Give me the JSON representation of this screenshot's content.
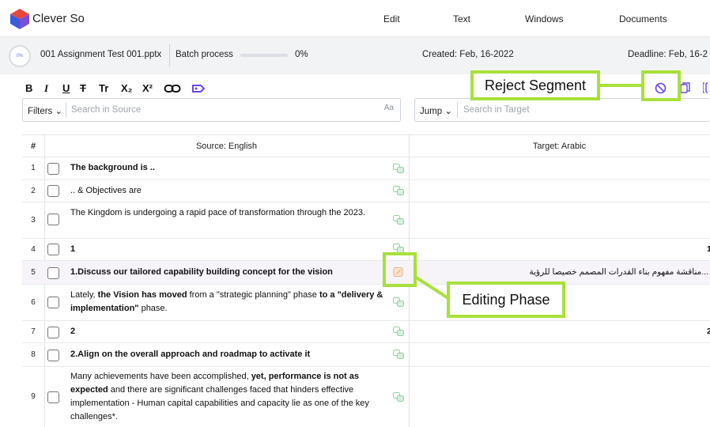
{
  "app": {
    "brand": "Clever So"
  },
  "nav": {
    "edit": "Edit",
    "text": "Text",
    "windows": "Windows",
    "documents": "Documents"
  },
  "filebar": {
    "progress": "0%",
    "filename": "001 Assignment Test 001.pptx",
    "batch_label": "Batch process",
    "batch_progress": 0,
    "batch_pct": "0%",
    "created": "Created: Feb, 16-2022",
    "deadline": "Deadline: Feb, 16-2"
  },
  "toolbar": {
    "bold": "B",
    "italic": "I",
    "underline": "U",
    "strike": "T",
    "font_size": "Tr",
    "subscript": "X₂",
    "superscript": "X²"
  },
  "filters": {
    "label": "Filters",
    "placeholder": "Search in Source",
    "case": "Aa"
  },
  "jump": {
    "label": "Jump",
    "placeholder": "Search in Target"
  },
  "table": {
    "col_num": "#",
    "col_source": "Source: English",
    "col_target": "Target: Arabic",
    "rows": [
      {
        "num": "1",
        "target": ""
      },
      {
        "num": "2",
        "target": ""
      },
      {
        "num": "3",
        "target": ""
      },
      {
        "num": "4",
        "target": "1"
      },
      {
        "num": "5",
        "target": "...مناقشة مفهوم بناء القدرات المصمم خصيصا للرؤية"
      },
      {
        "num": "6",
        "target": ""
      },
      {
        "num": "7",
        "target": "2"
      },
      {
        "num": "8",
        "target": ""
      },
      {
        "num": "9",
        "target": ""
      }
    ],
    "source": {
      "r1": "The background is ..",
      "r2": ".. & Objectives are",
      "r3": "The Kingdom is undergoing a rapid pace of transformation through the 2023.",
      "r4": "1",
      "r5": "1.Discuss our tailored capability building concept for the vision",
      "r6_a": "Lately, ",
      "r6_b": "the Vision has moved",
      "r6_c": " from a \"strategic planning\" phase ",
      "r6_d": "to a \"delivery & implementation\"",
      "r6_e": " phase.",
      "r7": "2",
      "r8": "2.Align on the overall approach and roadmap to activate it",
      "r9_a": "Many achievements have been accomplished, ",
      "r9_b": "yet, performance is not as expected",
      "r9_c": " and there are significant challenges faced that hinders effective implementation - Human capital capabilities and capacity lie as one of the key challenges*."
    }
  },
  "annotations": {
    "reject": "Reject Segment",
    "editing": "Editing Phase"
  },
  "colors": {
    "accent": "#6b46e5",
    "highlight": "#a9e03b",
    "tm_green": "#8fd19e",
    "edit_orange": "#f0b37a"
  }
}
